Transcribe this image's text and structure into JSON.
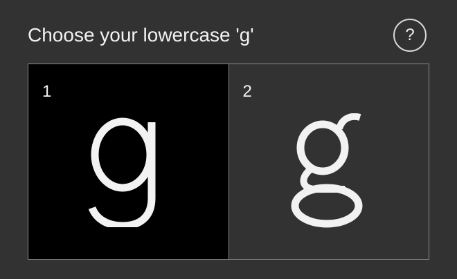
{
  "title": "Choose your lowercase 'g'",
  "help_label": "?",
  "options": [
    {
      "number": "1",
      "glyph": "g",
      "style": "single-storey",
      "selected": true
    },
    {
      "number": "2",
      "glyph": "g",
      "style": "double-storey",
      "selected": false
    }
  ],
  "colors": {
    "background": "#323232",
    "selected_background": "#000000",
    "text": "#f2f2f2",
    "border": "#8a8a8a"
  }
}
